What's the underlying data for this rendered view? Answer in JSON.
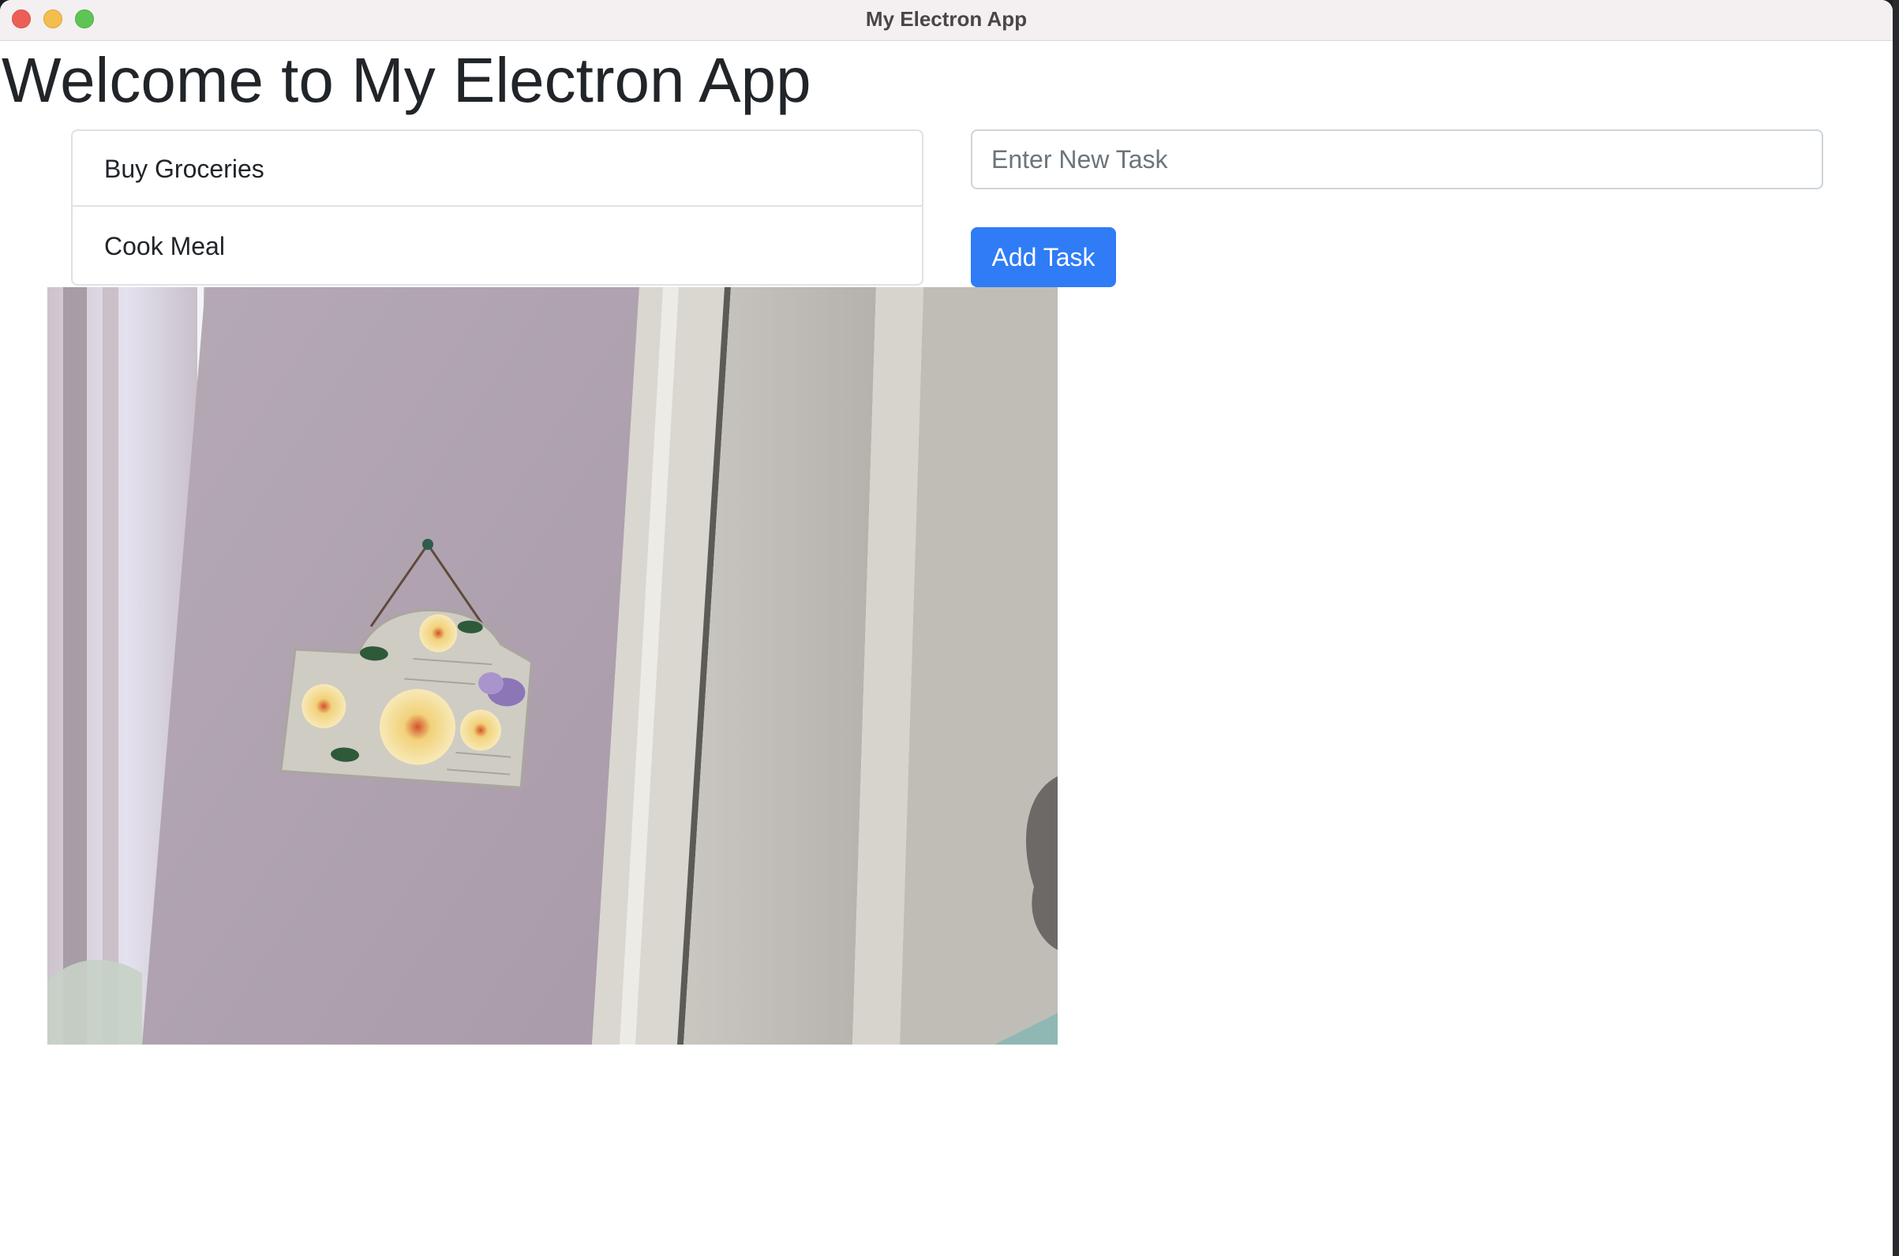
{
  "window": {
    "title": "My Electron App"
  },
  "page": {
    "heading": "Welcome to My Electron App"
  },
  "tasks": [
    {
      "label": "Buy Groceries"
    },
    {
      "label": "Cook Meal"
    }
  ],
  "new_task": {
    "placeholder": "Enter New Task",
    "value": ""
  },
  "actions": {
    "add_label": "Add Task"
  },
  "colors": {
    "primary_button": "#2f7cf6",
    "title_bar": "#f4eff0",
    "heading_text": "#212529"
  },
  "photo": {
    "subject": "webcam snapshot of a hanging floral plaque on a lavender wall beside a door frame"
  }
}
